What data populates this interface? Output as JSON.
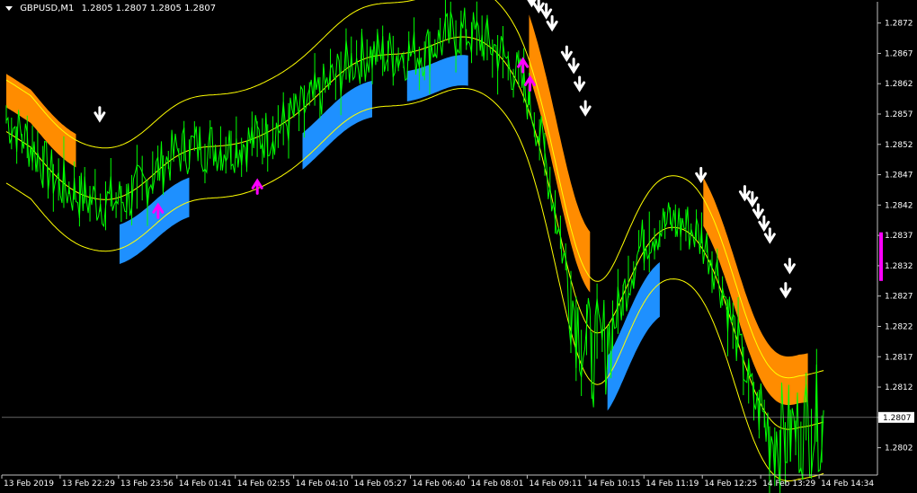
{
  "header": {
    "symbol_label": "GBPUSD,M1",
    "ohlc": "1.2805 1.2807 1.2805 1.2807"
  },
  "price_axis": {
    "ticks": [
      "1.2872",
      "1.2867",
      "1.2862",
      "1.2857",
      "1.2852",
      "1.2847",
      "1.2842",
      "1.2837",
      "1.2832",
      "1.2827",
      "1.2822",
      "1.2817",
      "1.2812",
      "1.2807",
      "1.2802"
    ],
    "current_price_label": "1.2807"
  },
  "time_axis": {
    "labels": [
      "13 Feb 2019",
      "13 Feb 22:29",
      "13 Feb 23:56",
      "14 Feb 01:41",
      "14 Feb 02:55",
      "14 Feb 04:10",
      "14 Feb 05:27",
      "14 Feb 06:40",
      "14 Feb 08:01",
      "14 Feb 09:11",
      "14 Feb 10:15",
      "14 Feb 11:19",
      "14 Feb 12:25",
      "14 Feb 13:29",
      "14 Feb 14:34"
    ]
  },
  "colors": {
    "background": "#000000",
    "price_line": "#00ff00",
    "band_line": "#ffff00",
    "bear_cloud": "#ff8c00",
    "bull_cloud": "#1e90ff",
    "sell_arrow": "#ffffff",
    "buy_arrow": "#ff00ff",
    "axis": "#c0c0c0",
    "axis_text": "#ffffff"
  },
  "chart_data": {
    "type": "line",
    "title": "GBPUSD,M1",
    "ylim": [
      1.27975,
      1.28755
    ],
    "current_price": 1.2807,
    "x_categories": [
      "13 Feb 2019",
      "13 Feb 22:29",
      "13 Feb 23:56",
      "14 Feb 01:41",
      "14 Feb 02:55",
      "14 Feb 04:10",
      "14 Feb 05:27",
      "14 Feb 06:40",
      "14 Feb 08:01",
      "14 Feb 09:11",
      "14 Feb 10:15",
      "14 Feb 11:19",
      "14 Feb 12:25",
      "14 Feb 13:29",
      "14 Feb 14:34"
    ],
    "series": [
      {
        "values": [
          1.2856,
          1.2845,
          1.2843,
          1.2851,
          1.2852,
          1.2857,
          1.2866,
          1.2867,
          1.287,
          1.2858,
          1.2818,
          1.2837,
          1.2835,
          1.2806,
          1.2807
        ]
      }
    ],
    "sell_signals": [
      {
        "x": 1.6,
        "y": 1.2856
      },
      {
        "x": 9.0,
        "y": 1.2875
      },
      {
        "x": 9.12,
        "y": 1.2874
      },
      {
        "x": 9.25,
        "y": 1.2873
      },
      {
        "x": 9.35,
        "y": 1.2871
      },
      {
        "x": 9.6,
        "y": 1.2866
      },
      {
        "x": 9.72,
        "y": 1.2864
      },
      {
        "x": 9.82,
        "y": 1.2861
      },
      {
        "x": 9.92,
        "y": 1.2857
      },
      {
        "x": 11.9,
        "y": 1.2846
      },
      {
        "x": 12.65,
        "y": 1.2843
      },
      {
        "x": 12.78,
        "y": 1.2842
      },
      {
        "x": 12.88,
        "y": 1.284
      },
      {
        "x": 12.98,
        "y": 1.2838
      },
      {
        "x": 13.08,
        "y": 1.2836
      },
      {
        "x": 13.42,
        "y": 1.2831
      },
      {
        "x": 13.35,
        "y": 1.2827
      }
    ],
    "buy_signals": [
      {
        "x": 2.6,
        "y": 1.2842
      },
      {
        "x": 4.3,
        "y": 1.2846
      },
      {
        "x": 8.85,
        "y": 1.2866
      },
      {
        "x": 8.97,
        "y": 1.2863
      }
    ]
  }
}
